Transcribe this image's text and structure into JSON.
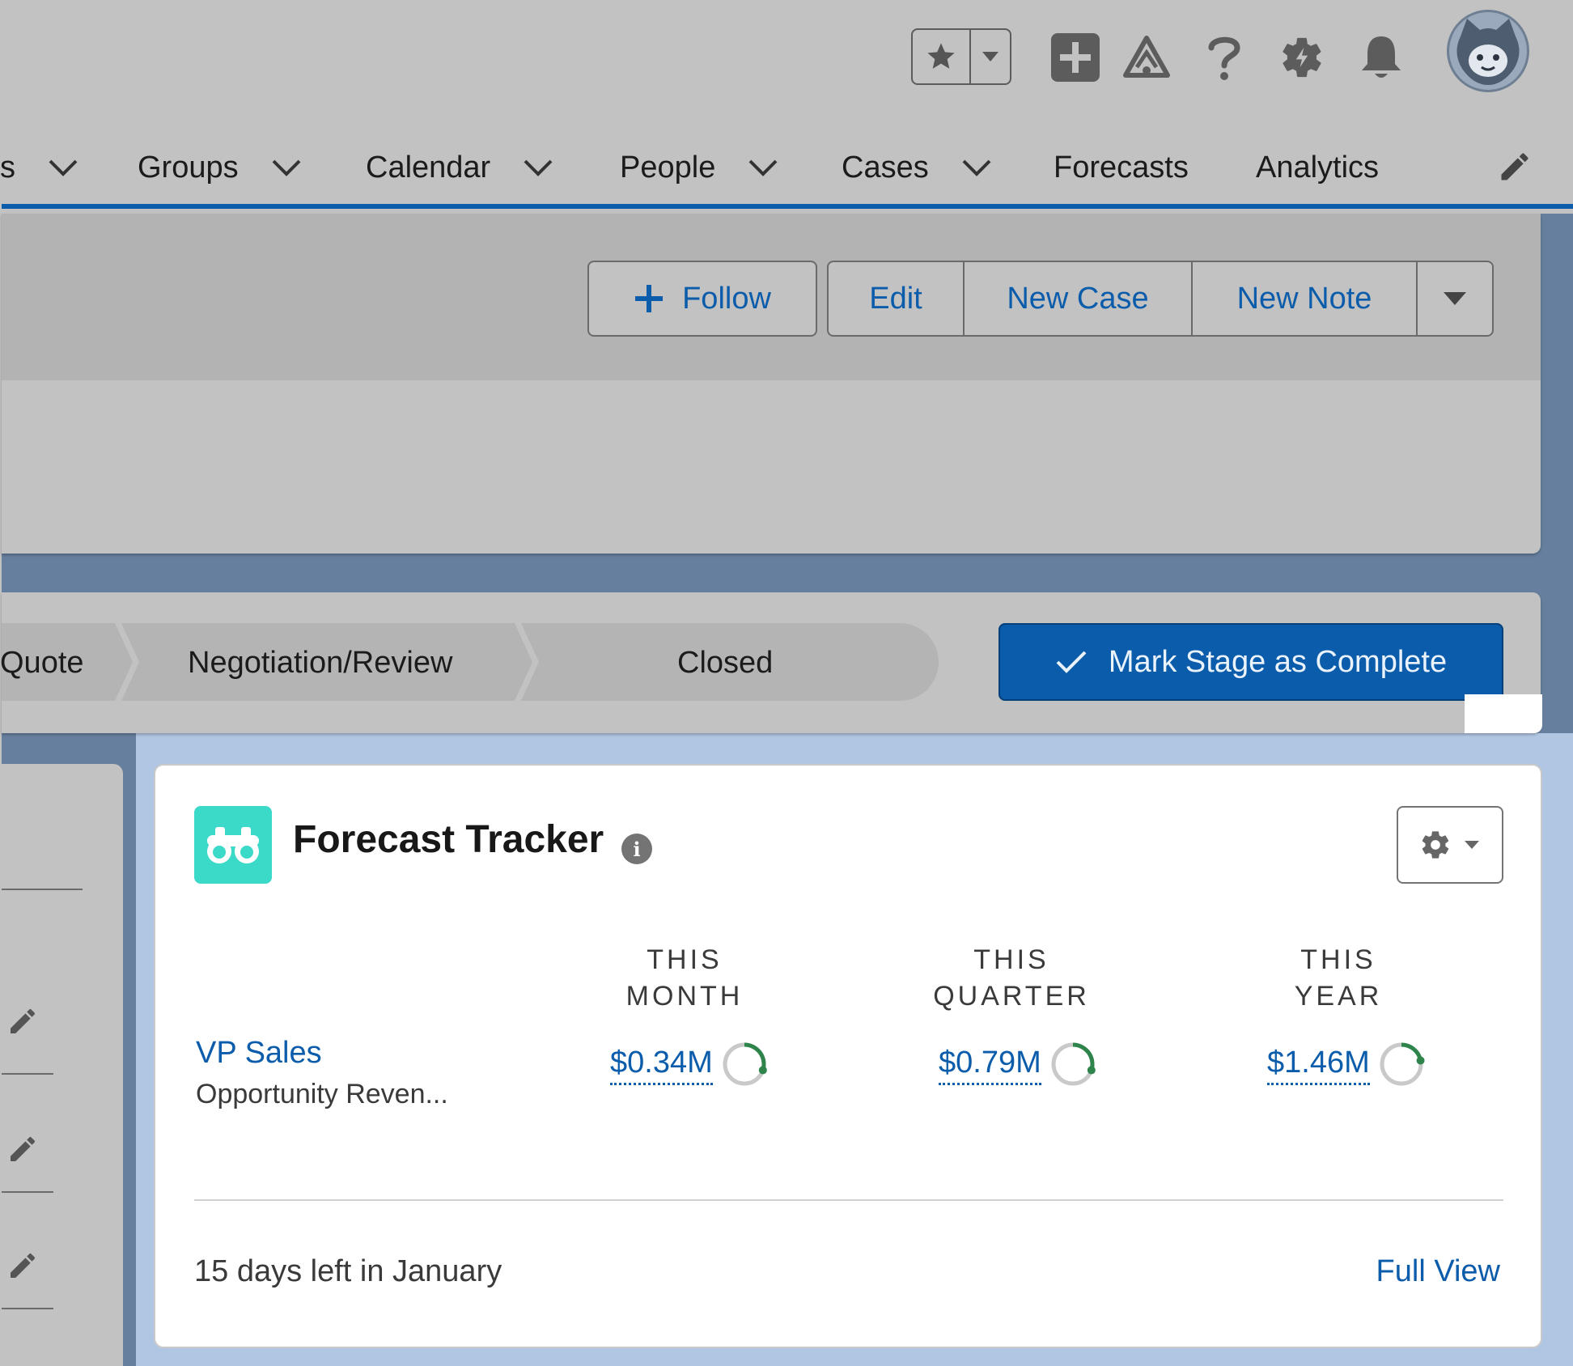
{
  "nav": {
    "items": [
      {
        "label": "s",
        "has_menu": true
      },
      {
        "label": "Groups",
        "has_menu": true
      },
      {
        "label": "Calendar",
        "has_menu": true
      },
      {
        "label": "People",
        "has_menu": true
      },
      {
        "label": "Cases",
        "has_menu": true
      },
      {
        "label": "Forecasts",
        "has_menu": false
      },
      {
        "label": "Analytics",
        "has_menu": false
      }
    ]
  },
  "header_icons": [
    "favorites-star-icon",
    "chevron-down-icon",
    "global-actions-add-icon",
    "trailhead-icon",
    "help-icon",
    "setup-gear-icon",
    "notifications-bell-icon",
    "user-avatar"
  ],
  "record_actions": {
    "follow_label": "Follow",
    "buttons": [
      "Edit",
      "New Case",
      "New Note"
    ]
  },
  "path": {
    "stages": [
      "Quote",
      "Negotiation/Review",
      "Closed"
    ],
    "complete_label": "Mark Stage as Complete"
  },
  "tracker": {
    "title": "Forecast Tracker",
    "info_glyph": "i",
    "periods": [
      {
        "line1": "THIS",
        "line2": "MONTH",
        "value": "$0.34M",
        "progress": 0.3
      },
      {
        "line1": "THIS",
        "line2": "QUARTER",
        "value": "$0.79M",
        "progress": 0.3
      },
      {
        "line1": "THIS",
        "line2": "YEAR",
        "value": "$1.46M",
        "progress": 0.22
      }
    ],
    "owner": "VP Sales",
    "metric": "Opportunity Reven...",
    "footer": "15 days left in January",
    "full_view": "Full View"
  },
  "colors": {
    "brand_blue": "#0b5cab",
    "progress_green": "#2e844a",
    "ring_track": "#c9c9c9",
    "tracker_icon": "#3bd9c8"
  }
}
